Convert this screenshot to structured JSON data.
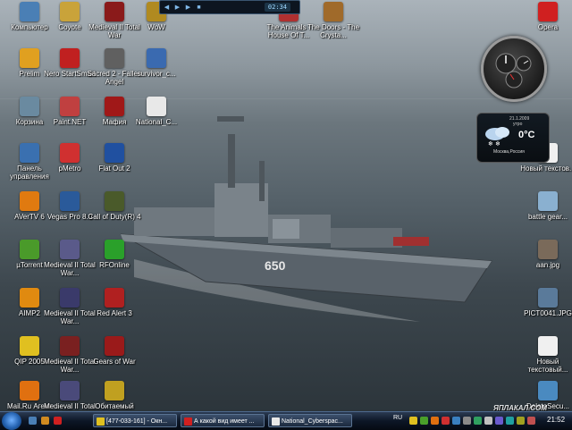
{
  "desktop_icons": [
    {
      "label": "Компьютер",
      "icon": "computer-icon",
      "color": "#4a7fb5"
    },
    {
      "label": "Coyote",
      "icon": "coyote-icon",
      "color": "#c9a33a"
    },
    {
      "label": "Medieval II Total War",
      "icon": "medieval-icon",
      "color": "#8a1a1a"
    },
    {
      "label": "WoW",
      "icon": "wow-icon",
      "color": "#b08a20"
    },
    {
      "label": "The Animals - House Of T...",
      "icon": "mp3-icon",
      "color": "#b03030"
    },
    {
      "label": "The Doors - The Crysta...",
      "icon": "mp3-icon",
      "color": "#a06a2a"
    },
    {
      "label": "Opera",
      "icon": "opera-icon",
      "color": "#d02020"
    },
    {
      "label": "Prelim",
      "icon": "prelim-icon",
      "color": "#e0a020"
    },
    {
      "label": "Nero StartSmart",
      "icon": "nero-icon",
      "color": "#c02020"
    },
    {
      "label": "Sacred 2 - Fallen Angel",
      "icon": "sacred-icon",
      "color": "#606060"
    },
    {
      "label": "survivor_c...",
      "icon": "file-icon",
      "color": "#3a6ab0"
    },
    {
      "label": "Корзина",
      "icon": "recycle-bin-icon",
      "color": "#6a8aa0"
    },
    {
      "label": "Paint.NET",
      "icon": "paint-icon",
      "color": "#c04040"
    },
    {
      "label": "Мафия",
      "icon": "mafia-icon",
      "color": "#a01818"
    },
    {
      "label": "National_C...",
      "icon": "document-icon",
      "color": "#e8e8e8"
    },
    {
      "label": "Панель управления",
      "icon": "control-panel-icon",
      "color": "#3a70b0"
    },
    {
      "label": "pMetro",
      "icon": "pmetro-icon",
      "color": "#d03030"
    },
    {
      "label": "Flat Out 2",
      "icon": "flatout-icon",
      "color": "#2050a0"
    },
    {
      "label": "Новый текстов...",
      "icon": "text-file-icon",
      "color": "#f0f0f0"
    },
    {
      "label": "AVerTV 6",
      "icon": "avertv-icon",
      "color": "#e07a10"
    },
    {
      "label": "Vegas Pro 8.0",
      "icon": "vegas-icon",
      "color": "#2a5a9a"
    },
    {
      "label": "Call of Duty(R) 4",
      "icon": "cod-icon",
      "color": "#4a5a2a"
    },
    {
      "label": "battle gear...",
      "icon": "image-icon",
      "color": "#8ab0d0"
    },
    {
      "label": "µTorrent",
      "icon": "utorrent-icon",
      "color": "#4a9a2a"
    },
    {
      "label": "Medieval II Total War...",
      "icon": "medieval-icon",
      "color": "#5a5a8a"
    },
    {
      "label": "RFOnline",
      "icon": "rfonline-icon",
      "color": "#2aa02a"
    },
    {
      "label": "aan.jpg",
      "icon": "image-icon",
      "color": "#7a6a5a"
    },
    {
      "label": "AIMP2",
      "icon": "aimp-icon",
      "color": "#e08a10"
    },
    {
      "label": "Medieval II Total War...",
      "icon": "medieval-icon",
      "color": "#3a3a6a"
    },
    {
      "label": "Red Alert 3",
      "icon": "redalert-icon",
      "color": "#b02020"
    },
    {
      "label": "PICT0041.JPG",
      "icon": "image-icon",
      "color": "#5a7a9a"
    },
    {
      "label": "QIP 2005",
      "icon": "qip-icon",
      "color": "#e0c020"
    },
    {
      "label": "Medieval II Total War...",
      "icon": "medieval-icon",
      "color": "#7a2020"
    },
    {
      "label": "Gears of War",
      "icon": "gears-icon",
      "color": "#9a1a1a"
    },
    {
      "label": "Новый текстовый...",
      "icon": "text-file-icon",
      "color": "#f0f0f0"
    },
    {
      "label": "Mail.Ru Агент",
      "icon": "mailru-icon",
      "color": "#e07010"
    },
    {
      "label": "Medieval II Total W...",
      "icon": "medieval-icon",
      "color": "#4a4a7a"
    },
    {
      "label": "Обитаемый",
      "icon": "obitaemy-icon",
      "color": "#c0a020"
    },
    {
      "label": "DeleteSecu...",
      "icon": "delete-icon",
      "color": "#4a8ac0"
    }
  ],
  "media_player": {
    "time": "02:34"
  },
  "weather": {
    "date": "21.1.2009",
    "day": "утро",
    "temp": "0°C",
    "location": "Москва,Россия"
  },
  "ship": {
    "hull_number": "650"
  },
  "taskbar": {
    "tasks": [
      {
        "label": "[477-033-161] - Окн...",
        "icon": "qip-icon",
        "color": "#e0c020"
      },
      {
        "label": "А какой вид имеет ...",
        "icon": "opera-icon",
        "color": "#d02020"
      },
      {
        "label": "National_Cyberspac...",
        "icon": "document-icon",
        "color": "#e8e8e8"
      }
    ],
    "language": "RU",
    "clock": "21:52"
  },
  "watermark": "ЯПЛАКАЛ.COM"
}
